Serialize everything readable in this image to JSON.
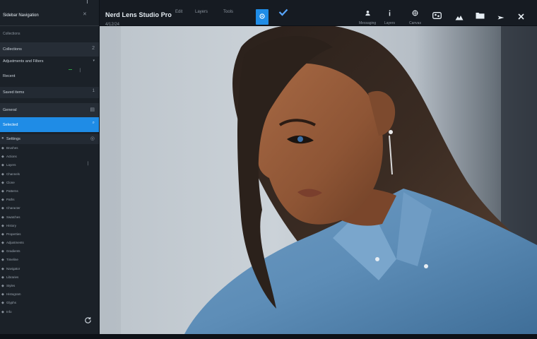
{
  "app": {
    "title": "Nerd Lens Studio Pro",
    "subtitle": "4/12/24"
  },
  "menu": {
    "item1": "Edit",
    "item2": "Layers",
    "item3": "Tools"
  },
  "toolbar_right": [
    {
      "icon": "user-icon",
      "label": "Messaging"
    },
    {
      "icon": "info-icon",
      "label": "Layers"
    },
    {
      "icon": "globe-icon",
      "label": "Canvas"
    },
    {
      "icon": "gallery-icon",
      "label": ""
    },
    {
      "icon": "share-icon",
      "label": ""
    },
    {
      "icon": "folder-icon",
      "label": ""
    },
    {
      "icon": "export-icon",
      "label": ""
    },
    {
      "icon": "close-icon",
      "label": ""
    }
  ],
  "sidebar": {
    "header": "Sidebar Navigation",
    "rows": {
      "collections": "Collections",
      "collections_count": "2",
      "adjustments": "Adjustments and Filters",
      "recent": "Recent",
      "saved": "Saved items",
      "saved_count": "1",
      "general": "General",
      "selected": "Selected",
      "settings": "Settings"
    },
    "list": [
      "Brushes",
      "Actions",
      "Layers",
      "Channels",
      "Clone",
      "Patterns",
      "Paths",
      "Character",
      "Swatches",
      "History",
      "Properties",
      "Adjustments",
      "Gradients",
      "Timeline",
      "Navigator",
      "Libraries",
      "Styles",
      "Histogram",
      "Glyphs",
      "Info"
    ]
  },
  "colors": {
    "accent": "#1f8ce6",
    "sidebar_bg": "#1b2128",
    "toolbar_bg": "#161b22"
  }
}
